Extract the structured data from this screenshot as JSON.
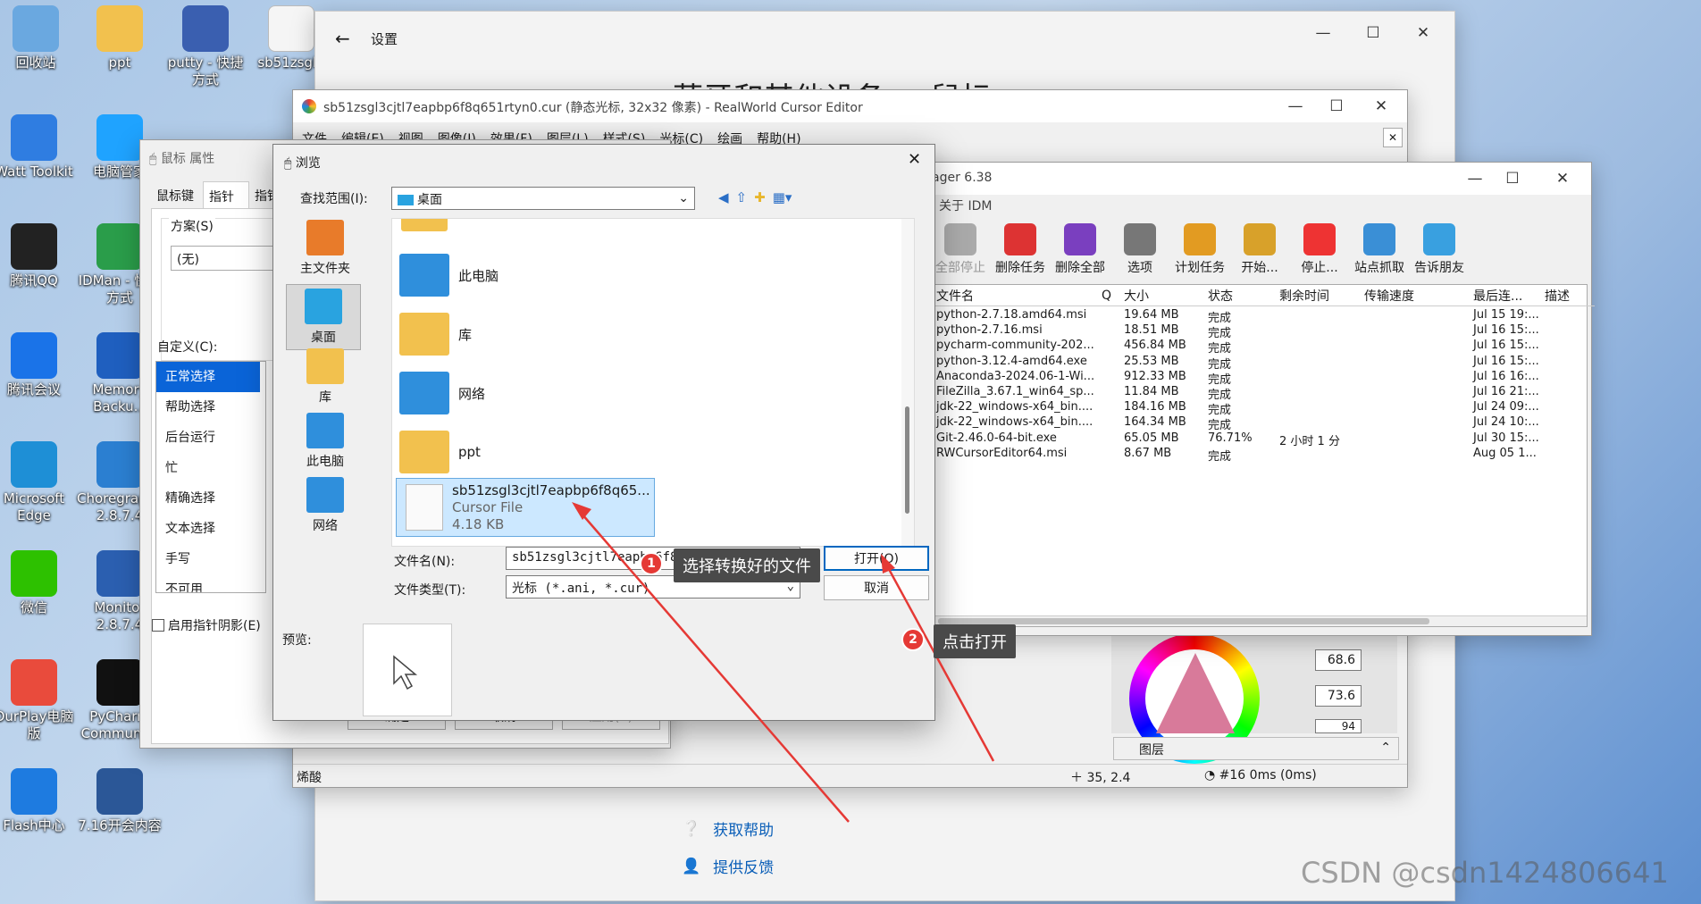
{
  "desktop_icons": [
    {
      "label": "回收站",
      "icon": "recycle-bin-icon",
      "color": "#6aa8e0"
    },
    {
      "label": "ppt",
      "icon": "folder-icon",
      "color": "#f2c14e"
    },
    {
      "label": "putty - 快捷方式",
      "icon": "putty-icon",
      "color": "#3a5fb0"
    },
    {
      "label": "sb51zsgl3",
      "icon": "file-icon",
      "color": "#f5f5f5"
    },
    {
      "label": "Watt Toolkit",
      "icon": "watt-toolkit-icon",
      "color": "#2f7de1"
    },
    {
      "label": "电脑管家",
      "icon": "pc-manager-icon",
      "color": "#1fa3ff"
    },
    {
      "label": "腾讯QQ",
      "icon": "qq-icon",
      "color": "#222"
    },
    {
      "label": "IDMan - 快捷方式",
      "icon": "idm-icon",
      "color": "#2a9d4a"
    },
    {
      "label": "腾讯会议",
      "icon": "tencent-meeting-icon",
      "color": "#1a73e8"
    },
    {
      "label": "Memory Backu...",
      "icon": "memory-backup-icon",
      "color": "#1f5fbf"
    },
    {
      "label": "Microsoft Edge",
      "icon": "edge-icon",
      "color": "#1e8fd6"
    },
    {
      "label": "Choregraphe 2.8.7.4",
      "icon": "choregraphe-icon",
      "color": "#2b7fd1"
    },
    {
      "label": "微信",
      "icon": "wechat-icon",
      "color": "#2dc100"
    },
    {
      "label": "Monitor 2.8.7.4",
      "icon": "monitor-icon",
      "color": "#2b5fb0"
    },
    {
      "label": "OurPlay电脑版",
      "icon": "ourplay-icon",
      "color": "#e94b3c"
    },
    {
      "label": "PyCharm Community",
      "icon": "pycharm-icon",
      "color": "#111"
    },
    {
      "label": "Flash中心",
      "icon": "flash-icon",
      "color": "#1e7be0"
    },
    {
      "label": "7.16开会内容",
      "icon": "word-doc-icon",
      "color": "#2b5797"
    }
  ],
  "settings": {
    "title": "设置",
    "heading": "蓝牙和其他设备 > 鼠标",
    "help": "获取帮助",
    "feedback": "提供反馈"
  },
  "realworld": {
    "title": "sb51zsgl3cjtl7eapbp6f8q651rtyn0.cur (静态光标, 32x32 像素) - RealWorld Cursor Editor",
    "menu": [
      "文件",
      "编辑(E)",
      "视图",
      "图像(I)",
      "效果(F)",
      "图层(L)",
      "样式(S)",
      "光标(C)",
      "绘画",
      "帮助(H)"
    ],
    "val1": "68.6",
    "val2": "73.6",
    "val3": "94",
    "layers": "图层",
    "status_left": "烯酸",
    "coords": "35, 2.4",
    "timing": "#16 0ms (0ms)"
  },
  "mouse_props": {
    "title": "鼠标 属性",
    "tabs": [
      "鼠标键",
      "指针",
      "指针"
    ],
    "scheme_label": "方案(S)",
    "scheme_value": "(无)",
    "custom_label": "自定义(C):",
    "items": [
      "正常选择",
      "帮助选择",
      "后台运行",
      "忙",
      "精确选择",
      "文本选择",
      "手写",
      "不可用"
    ],
    "shadow_label": "启用指针阴影(E)",
    "ok": "确定",
    "cancel": "取消",
    "apply": "应用(A)"
  },
  "idm": {
    "title_suffix": "ager 6.38",
    "menu": "关于 IDM",
    "toolbar": [
      "全部停止",
      "删除任务",
      "删除全部",
      "选项",
      "计划任务",
      "开始...",
      "停止...",
      "站点抓取",
      "告诉朋友"
    ],
    "columns": [
      "文件名",
      "Q",
      "大小",
      "状态",
      "剩余时间",
      "传输速度",
      "最后连...",
      "描述"
    ],
    "rows": [
      [
        "python-2.7.18.amd64.msi",
        "",
        "19.64  MB",
        "完成",
        "",
        "",
        "Jul 15 19:..."
      ],
      [
        "python-2.7.16.msi",
        "",
        "18.51  MB",
        "完成",
        "",
        "",
        "Jul 16 15:..."
      ],
      [
        "pycharm-community-202...",
        "",
        "456.84  MB",
        "完成",
        "",
        "",
        "Jul 16 15:..."
      ],
      [
        "python-3.12.4-amd64.exe",
        "",
        "25.53  MB",
        "完成",
        "",
        "",
        "Jul 16 15:..."
      ],
      [
        "Anaconda3-2024.06-1-Wi...",
        "",
        "912.33  MB",
        "完成",
        "",
        "",
        "Jul 16 16:..."
      ],
      [
        "FileZilla_3.67.1_win64_sp...",
        "",
        "11.84  MB",
        "完成",
        "",
        "",
        "Jul 16 21:..."
      ],
      [
        "jdk-22_windows-x64_bin....",
        "",
        "184.16  MB",
        "完成",
        "",
        "",
        "Jul 24 09:..."
      ],
      [
        "jdk-22_windows-x64_bin....",
        "",
        "164.34  MB",
        "完成",
        "",
        "",
        "Jul 24 10:..."
      ],
      [
        "Git-2.46.0-64-bit.exe",
        "",
        "65.05  MB",
        "76.71%",
        "2 小时 1 分",
        "",
        "Jul 30 15:..."
      ],
      [
        "RWCursorEditor64.msi",
        "",
        "8.67  MB",
        "完成",
        "",
        "",
        "Aug 05 1..."
      ]
    ]
  },
  "browse": {
    "title": "浏览",
    "lookin_label": "查找范围(I):",
    "lookin_value": "桌面",
    "nav": [
      "主文件夹",
      "桌面",
      "库",
      "此电脑",
      "网络"
    ],
    "items": [
      "此电脑",
      "库",
      "网络",
      "ppt"
    ],
    "selected": {
      "name": "sb51zsgl3cjtl7eapbp6f8q65...",
      "type": "Cursor File",
      "size": "4.18 KB"
    },
    "filename_label": "文件名(N):",
    "filename_value": "sb51zsgl3cjtl7eapbp6f8q651rtyn0",
    "filetype_label": "文件类型(T):",
    "filetype_value": "光标 (*.ani, *.cur)",
    "open": "打开(O)",
    "cancel": "取消",
    "preview": "预览:"
  },
  "annotations": {
    "step1": "选择转换好的文件",
    "step2": "点击打开",
    "n1": "1",
    "n2": "2"
  },
  "watermark": "CSDN @csdn1424806641"
}
